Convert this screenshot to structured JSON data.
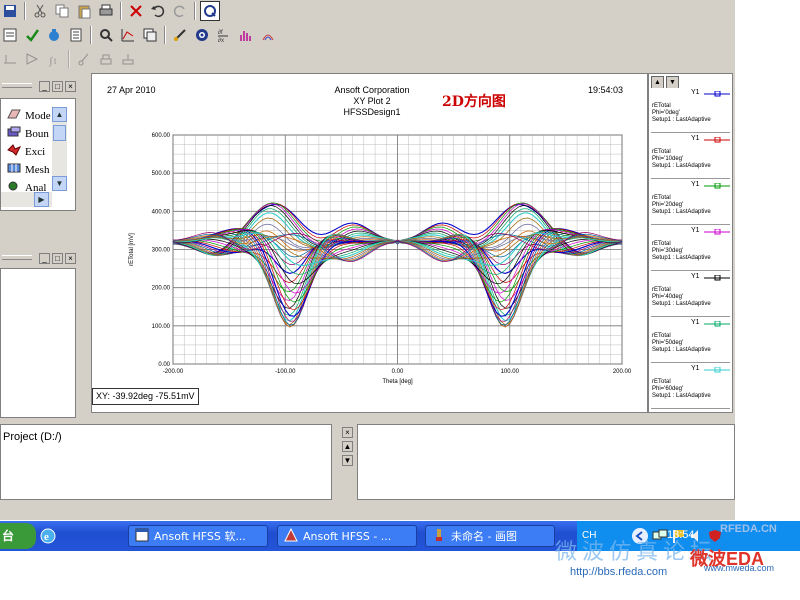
{
  "plot": {
    "date": "27 Apr 2010",
    "company": "Ansoft Corporation",
    "name": "XY Plot 2",
    "design": "HFSSDesign1",
    "time": "19:54:03",
    "annotation": "2D方向图",
    "annotation_color": "#cc0000"
  },
  "chart_data": {
    "type": "line",
    "xlabel": "Theta [deg]",
    "ylabel": "rETotal [mV]",
    "xlim": [
      -200,
      200
    ],
    "ylim": [
      0,
      600
    ],
    "xticks": [
      "-200.00",
      "-100.00",
      "0.00",
      "100.00",
      "200.00"
    ],
    "yticks": [
      "0.00",
      "100.00",
      "200.00",
      "300.00",
      "400.00",
      "500.00",
      "600.00"
    ],
    "grid": true,
    "series_colors": [
      "#0000cc",
      "#cc0000",
      "#009900",
      "#cc00cc",
      "#000000",
      "#00aa66",
      "#33cccc",
      "#996600",
      "#666699",
      "#cc6600",
      "#006699",
      "#990066"
    ]
  },
  "cursor_readout": "XY: -39.92deg -75.51mV",
  "legend": [
    {
      "tag": "Y1",
      "l1": "rETotal",
      "l2": "Phi='0deg'",
      "l3": "Setup1 : LastAdaptive",
      "color": "#0000cc"
    },
    {
      "tag": "Y1",
      "l1": "rETotal",
      "l2": "Phi='10deg'",
      "l3": "Setup1 : LastAdaptive",
      "color": "#cc0000"
    },
    {
      "tag": "Y1",
      "l1": "rETotal",
      "l2": "Phi='20deg'",
      "l3": "Setup1 : LastAdaptive",
      "color": "#009900"
    },
    {
      "tag": "Y1",
      "l1": "rETotal",
      "l2": "Phi='30deg'",
      "l3": "Setup1 : LastAdaptive",
      "color": "#cc00cc"
    },
    {
      "tag": "Y1",
      "l1": "rETotal",
      "l2": "Phi='40deg'",
      "l3": "Setup1 : LastAdaptive",
      "color": "#000000"
    },
    {
      "tag": "Y1",
      "l1": "rETotal",
      "l2": "Phi='50deg'",
      "l3": "Setup1 : LastAdaptive",
      "color": "#00aa66"
    },
    {
      "tag": "Y1",
      "l1": "rETotal",
      "l2": "Phi='60deg'",
      "l3": "Setup1 : LastAdaptive",
      "color": "#33cccc"
    }
  ],
  "tree": {
    "items": [
      "Mode",
      "Boun",
      "Exci",
      "Mesh",
      "Anal"
    ]
  },
  "project": {
    "label": "Project (D:/)"
  },
  "taskbar": {
    "start": "台",
    "tasks": [
      "Ansoft HFSS 软...",
      "Ansoft HFSS - ...",
      "未命名 - 画图"
    ],
    "lang": "CH",
    "clock": "13:54"
  },
  "watermark": {
    "site": "RFEDA.CN",
    "brand": "微波仿真论坛",
    "url": "http://bbs.rfeda.com",
    "url2": "www.mweda.com",
    "logo": "微波EDA"
  }
}
